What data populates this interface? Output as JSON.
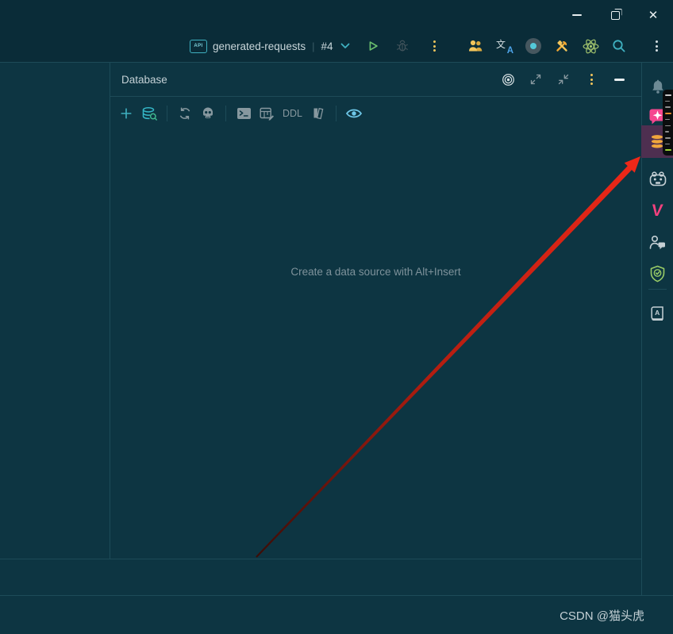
{
  "window": {
    "controls": {
      "minimize": "minimize",
      "restore": "restore",
      "close": "✕"
    }
  },
  "titlebar": {
    "run_widget": {
      "file_badge": "API",
      "config_name": "generated-requests",
      "divider": "|",
      "execution_label": "#4"
    },
    "translate": {
      "cjk": "文",
      "latin": "A"
    },
    "right_actions": [
      "users",
      "translate",
      "screen-record",
      "tools",
      "atom",
      "search",
      "more"
    ]
  },
  "database_panel": {
    "title": "Database",
    "header_actions": [
      "locate-target",
      "expand",
      "collapse",
      "options-menu",
      "hide"
    ],
    "toolbar": {
      "ddl_label": "DDL",
      "items": [
        "new-data-source",
        "search-data-source",
        "refresh",
        "disconnect",
        "query-console",
        "table-editor",
        "ddl-viewer",
        "documentation",
        "preview"
      ]
    },
    "empty_hint": "Create a data source with Alt+Insert"
  },
  "right_sidebar": {
    "v_logo": "V",
    "dictionary_letter": "A",
    "tools": [
      "notifications",
      "ai-assistant",
      "database",
      "robot-assistant",
      "v-plugin",
      "code-with-me",
      "security-shield",
      "dictionary"
    ]
  },
  "statusbar": {
    "watermark": "CSDN @猫头虎"
  },
  "colors": {
    "background": "#0d3542",
    "titlebar": "#0a2c38",
    "border": "#1d4b58",
    "teal_accent": "#3fb0c0",
    "run_green": "#6abf6e",
    "warning_yellow": "#f2c55c",
    "tools_orange": "#f0a732",
    "ai_pink": "#f5478f",
    "db_orange": "#f0a63c",
    "selected_purple": "#4e2f50",
    "arrow_red": "#e82818",
    "shield_green": "#99cc66",
    "eye_blue": "#6fc8e9"
  }
}
